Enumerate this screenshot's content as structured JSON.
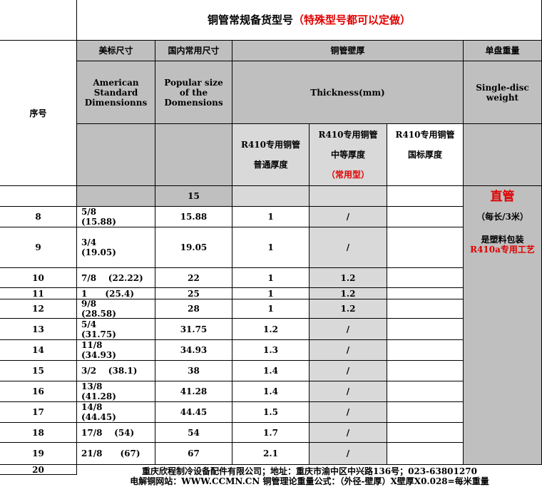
{
  "title": {
    "main": "铜管常规备货型号",
    "note": "（特殊型号都可以定做）"
  },
  "headers": {
    "seq": "序号",
    "american_cn": "美标尺寸",
    "american_en": "American\nStandard\nDimensionns",
    "popular_cn": "国内常用尺寸",
    "popular_en": "Popular size\nof the\nDomensions",
    "thickness_cn": "铜管壁厚",
    "thickness_en": "Thickness(mm)",
    "weight_cn": "单盘重量",
    "weight_en": "Single-disc\nweight",
    "sub": [
      {
        "line1": "R410专用铜管",
        "line2": "普通厚度",
        "line3": ""
      },
      {
        "line1": "R410专用铜管",
        "line2": "中等厚度",
        "line3": "（常用型）"
      },
      {
        "line1": "R410专用铜管",
        "line2": "国标厚度",
        "line3": ""
      }
    ]
  },
  "weight_note": {
    "line1": "直管",
    "line2": "（每长/3米）",
    "line3": "是塑料包装",
    "line4": "R410a专用工艺"
  },
  "rows": [
    {
      "seq": "",
      "american": "",
      "popular": "15",
      "t1": "",
      "t2": "",
      "t3": ""
    },
    {
      "seq": "8",
      "american": "5/8\n(15.88)",
      "popular": "15.88",
      "t1": "1",
      "t2": "/",
      "t3": ""
    },
    {
      "seq": "9",
      "american": "3/4\n(19.05)",
      "popular": "19.05",
      "t1": "1",
      "t2": "/",
      "t3": ""
    },
    {
      "seq": "10",
      "american": "7/8    (22.22)",
      "popular": "22",
      "t1": "1",
      "t2": "1.2",
      "t3": ""
    },
    {
      "seq": "11",
      "american": "1      (25.4)",
      "popular": "25",
      "t1": "1",
      "t2": "1.2",
      "t3": ""
    },
    {
      "seq": "12",
      "american": "9/8\n(28.58)",
      "popular": "28",
      "t1": "1",
      "t2": "1.2",
      "t3": ""
    },
    {
      "seq": "13",
      "american": "5/4\n(31.75)",
      "popular": "31.75",
      "t1": "1.2",
      "t2": "/",
      "t3": ""
    },
    {
      "seq": "14",
      "american": "11/8\n(34.93)",
      "popular": "34.93",
      "t1": "1.3",
      "t2": "/",
      "t3": ""
    },
    {
      "seq": "15",
      "american": "3/2    (38.1)",
      "popular": "38",
      "t1": "1.4",
      "t2": "/",
      "t3": ""
    },
    {
      "seq": "16",
      "american": "13/8\n(41.28)",
      "popular": "41.28",
      "t1": "1.4",
      "t2": "/",
      "t3": ""
    },
    {
      "seq": "17",
      "american": "14/8\n(44.45)",
      "popular": "44.45",
      "t1": "1.5",
      "t2": "/",
      "t3": ""
    },
    {
      "seq": "18",
      "american": "17/8    (54)",
      "popular": "54",
      "t1": "1.7",
      "t2": "/",
      "t3": ""
    },
    {
      "seq": "19",
      "american": "21/8      (67)",
      "popular": "67",
      "t1": "2.1",
      "t2": "/",
      "t3": ""
    },
    {
      "seq": "20",
      "american": "",
      "popular": "",
      "t1": "",
      "t2": "",
      "t3": ""
    }
  ],
  "footer": {
    "line1": "重庆欣程制冷设备配件有限公司；地址：重庆市渝中区中兴路136号；023-63801270",
    "line2": "电解铜网站：WWW.CCMN.CN 铜管理论重量公式：（外径-壁厚）X壁厚X0.028=每米重量"
  }
}
